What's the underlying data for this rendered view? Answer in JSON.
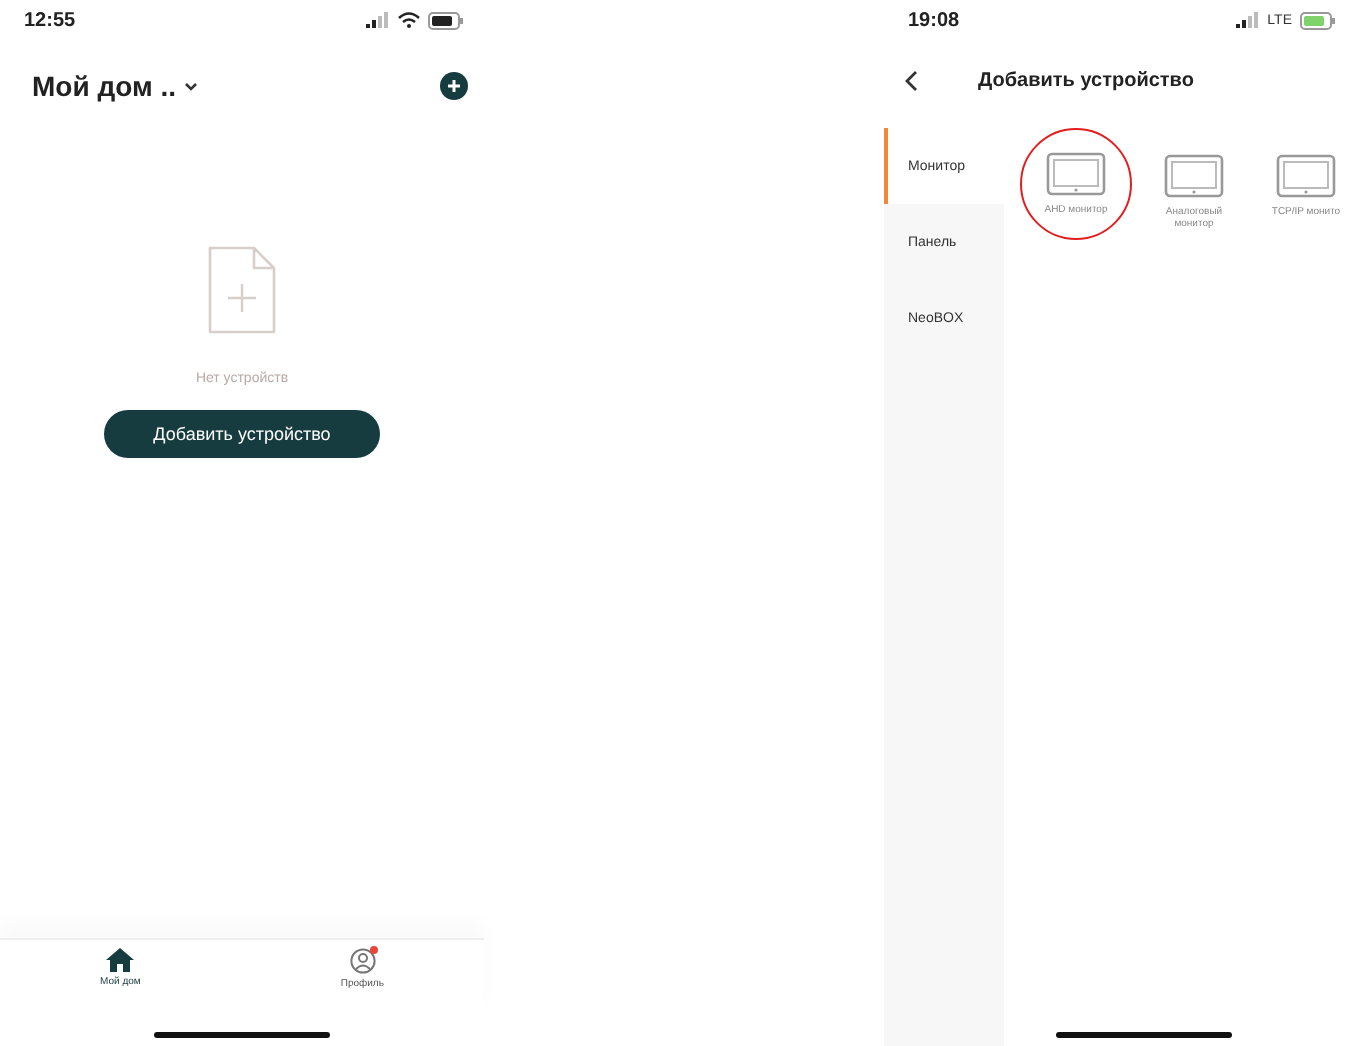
{
  "home_screen": {
    "status_bar": {
      "time": "12:55"
    },
    "header": {
      "title": "Мой дом .."
    },
    "empty_state": {
      "message": "Нет устройств",
      "button": "Добавить устройство"
    },
    "tab_bar": [
      {
        "label": "Мой дом",
        "kind": "home",
        "selected": true,
        "notification": false
      },
      {
        "label": "Профиль",
        "kind": "profile",
        "selected": false,
        "notification": true
      }
    ]
  },
  "add_device_screen": {
    "status_bar": {
      "time": "19:08",
      "network": "LTE"
    },
    "header": {
      "title": "Добавить устройство"
    },
    "categories": [
      {
        "label": "Монитор",
        "selected": true
      },
      {
        "label": "Панель",
        "selected": false
      },
      {
        "label": "NeoBOX",
        "selected": false
      }
    ],
    "devices": [
      {
        "label": "AHD монитор",
        "circled": true
      },
      {
        "label": "Аналоговый монитор",
        "circled": false
      },
      {
        "label": "TCP/IP монито",
        "circled": false
      }
    ]
  }
}
